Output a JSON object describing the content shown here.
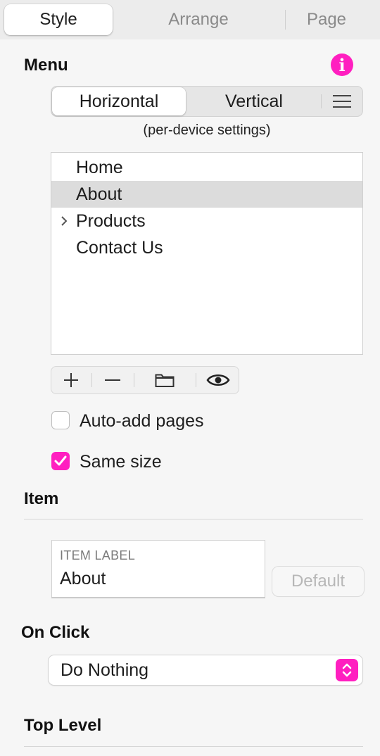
{
  "tabs": [
    {
      "label": "Style",
      "active": true
    },
    {
      "label": "Arrange",
      "active": false
    },
    {
      "label": "Page",
      "active": false
    }
  ],
  "menu": {
    "title": "Menu",
    "info_icon": "info-icon",
    "orientation": {
      "options": [
        "Horizontal",
        "Vertical"
      ],
      "selected": "Horizontal",
      "extra_icon": "hamburger-icon"
    },
    "hint": "(per-device settings)",
    "items": [
      {
        "label": "Home",
        "selected": false,
        "expandable": false
      },
      {
        "label": "About",
        "selected": true,
        "expandable": false
      },
      {
        "label": "Products",
        "selected": false,
        "expandable": true
      },
      {
        "label": "Contact Us",
        "selected": false,
        "expandable": false
      }
    ],
    "toolbar_icons": [
      "plus-icon",
      "minus-icon",
      "folder-icon",
      "eye-icon"
    ],
    "auto_add_pages": {
      "label": "Auto-add pages",
      "checked": false
    },
    "same_size": {
      "label": "Same size",
      "checked": true
    }
  },
  "item": {
    "title": "Item",
    "label_caption": "ITEM LABEL",
    "label_value": "About",
    "default_button": "Default"
  },
  "on_click": {
    "title": "On Click",
    "selected": "Do Nothing"
  },
  "top_level": {
    "title": "Top Level"
  },
  "colors": {
    "accent": "#ff1fc0",
    "background": "#f6f6f6",
    "selected_row": "#dcdcdc"
  }
}
